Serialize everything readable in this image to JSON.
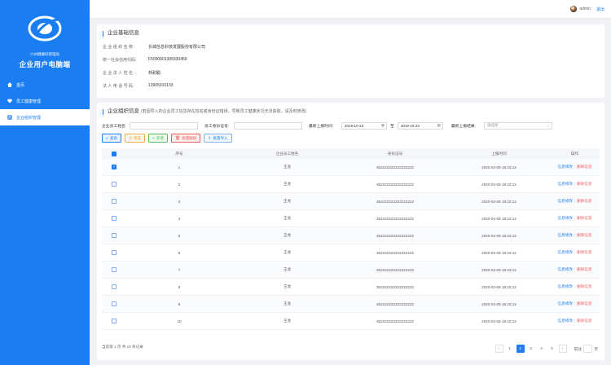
{
  "sidebar": {
    "brand_sub": "六州健康码管理局",
    "brand_title": "企业用户电脑端",
    "items": [
      {
        "label": "首页",
        "icon": "home-icon"
      },
      {
        "label": "员工健康管理",
        "icon": "heart-icon"
      },
      {
        "label": "企业组织管理",
        "icon": "stack-icon",
        "active": true
      }
    ]
  },
  "topbar": {
    "user": "admin",
    "logout": "退出"
  },
  "basic_info": {
    "title": "企业基础信息",
    "rows": [
      {
        "label": "企业组织名称:",
        "value": "长城信息科技发展股份有限公司"
      },
      {
        "label": "统一社会信用代码:",
        "value": "F5000901395930459"
      },
      {
        "label": "企业法人姓名:",
        "value": "林耐聪"
      },
      {
        "label": "法人电话号码:",
        "value": "13905910133"
      }
    ]
  },
  "org_info": {
    "title": "企业组织信息",
    "hint": "(若因导入的企业员工信息存在姓名或身份证错误，导致员工健康状况无法获取，请及时修改)",
    "filters": {
      "name_label": "企业员工姓名:",
      "name_value": "",
      "id_label": "员工身份证号:",
      "id_value": "",
      "time_label": "最新上报时间:",
      "date_from": "2019-10-23",
      "to_label": "至",
      "date_to": "2019-10-23",
      "result_label": "最新上报结果:",
      "result_placeholder": "请选择"
    },
    "buttons": {
      "query": "查询",
      "reset": "重置",
      "add": "新增",
      "batch_delete": "批量删除",
      "batch_import": "批量导入"
    }
  },
  "table": {
    "columns": [
      "序号",
      "企业员工姓名",
      "身份证号",
      "上报时间",
      "操作"
    ],
    "rows": [
      {
        "no": "1",
        "name": "王龙",
        "id": "352222222222222222",
        "time": "2020-02-08 18:23:12",
        "checked": true
      },
      {
        "no": "2",
        "name": "王龙",
        "id": "352222222222222222",
        "time": "2020-02-08 18:23:12",
        "checked": false
      },
      {
        "no": "3",
        "name": "王龙",
        "id": "352222222222222222",
        "time": "2020-02-08 18:23:12",
        "checked": false
      },
      {
        "no": "4",
        "name": "王龙",
        "id": "352222222222222222",
        "time": "2020-02-08 18:23:12",
        "checked": false
      },
      {
        "no": "5",
        "name": "王龙",
        "id": "352222222222222222",
        "time": "2020-02-08 18:23:12",
        "checked": false
      },
      {
        "no": "6",
        "name": "王龙",
        "id": "352222222222222222",
        "time": "2020-02-08 18:23:12",
        "checked": false
      },
      {
        "no": "7",
        "name": "王龙",
        "id": "352222222222222222",
        "time": "2020-02-08 18:23:12",
        "checked": false
      },
      {
        "no": "8",
        "name": "王龙",
        "id": "352222222222222222",
        "time": "2020-02-08 18:23:12",
        "checked": false
      },
      {
        "no": "9",
        "name": "王龙",
        "id": "352222222222222222",
        "time": "2020-02-08 18:23:12",
        "checked": false
      },
      {
        "no": "10",
        "name": "王龙",
        "id": "352222222222222222",
        "time": "2020-02-08 18:23:12",
        "checked": false
      }
    ],
    "op_edit": "信息修改",
    "op_delete": "删除信息"
  },
  "pagination": {
    "summary": "当前第 1 页 共 10 条记录",
    "pages": [
      "1",
      "2",
      "3",
      "4",
      "5"
    ],
    "current": "2",
    "goto_label": "前往",
    "goto_suffix": "页"
  },
  "colors": {
    "accent": "#1a7ef2",
    "danger": "#e85c5c"
  }
}
